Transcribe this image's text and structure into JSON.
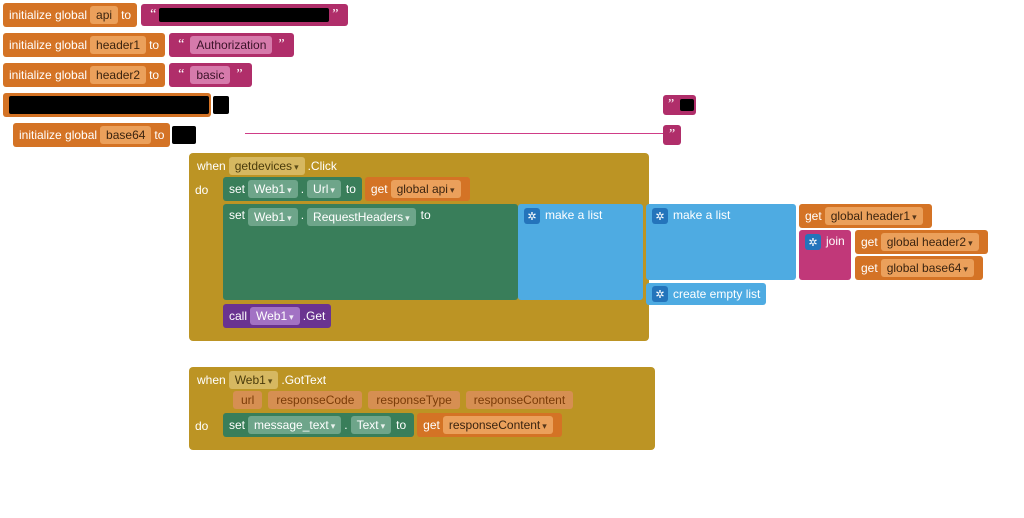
{
  "globals": {
    "init_label": "initialize global",
    "to_label": "to",
    "api": {
      "name": "api",
      "value_redacted": true
    },
    "header1": {
      "name": "header1",
      "value": "Authorization"
    },
    "header2": {
      "name": "header2",
      "value": "basic"
    },
    "row4": {
      "redacted": true
    },
    "base64": {
      "name": "base64",
      "value_redacted": true
    }
  },
  "event1": {
    "when": "when",
    "component": "getdevices",
    "event": ".Click",
    "do": "do",
    "set": "set",
    "web1": "Web1",
    "url": "Url",
    "to": "to",
    "reqheaders": "RequestHeaders",
    "get": "get",
    "global_api": "global api",
    "make_a_list": "make a list",
    "create_empty_list": "create empty list",
    "global_header1": "global header1",
    "join": "join",
    "global_header2": "global header2",
    "global_base64": "global base64",
    "call": "call",
    "get_method": ".Get"
  },
  "event2": {
    "when": "when",
    "component": "Web1",
    "event": ".GotText",
    "params": [
      "url",
      "responseCode",
      "responseType",
      "responseContent"
    ],
    "do": "do",
    "set": "set",
    "msgtext": "message_text",
    "text": "Text",
    "to": "to",
    "get": "get",
    "responseContent": "responseContent"
  }
}
